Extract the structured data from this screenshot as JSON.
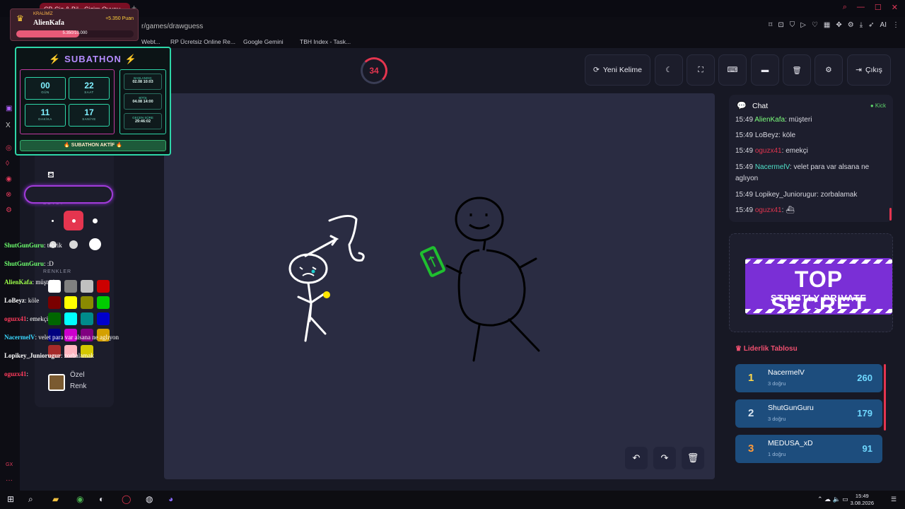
{
  "browser": {
    "tab_title": "ÇB Çiz & Bil - Çizim Oyunu",
    "url": "r/games/drawguess",
    "bookmarks": [
      "Webt...",
      "RP Ücretsiz Online Re...",
      "Google Gemini",
      "TBH Index - Task..."
    ],
    "ext_ai": "AI"
  },
  "crown": {
    "badge": "KRALİMİZ",
    "name": "AlienKafa",
    "points": "+5.350 Puan",
    "progress_text": "5.350/10.000",
    "progress_fraction": 0.535
  },
  "subathon": {
    "title": "⚡ SUBATHON ⚡",
    "days": "00",
    "days_lbl": "GÜN",
    "hours": "22",
    "hours_lbl": "SAAT",
    "minutes": "11",
    "minutes_lbl": "DAKİKA",
    "seconds": "17",
    "seconds_lbl": "SANİYE",
    "start_lbl": "BAŞLANGIÇ",
    "start": "02.08 10:03",
    "end_lbl": "BİTİŞ",
    "end": "04.08 14:00",
    "elapsed_lbl": "GEÇEN SÜRE",
    "elapsed": "29:46:02",
    "status": "🔥 SUBATHON AKTİF 🔥"
  },
  "game": {
    "timer": "34",
    "buttons": {
      "new_word": "Yeni Kelime",
      "exit": "Çıkış"
    }
  },
  "tools": {
    "size_label": "BOYUT",
    "colors_label": "RENKLER",
    "custom_color_line1": "Özel",
    "custom_color_line2": "Renk",
    "swatches": [
      "#ffffff",
      "#808080",
      "#c0c0c0",
      "#cc0000",
      "#7a0000",
      "#ffff00",
      "#8a8a00",
      "#00cc00",
      "#006600",
      "#00ffff",
      "#008b8b",
      "#0000cc",
      "#000080",
      "#cc00cc",
      "#800080",
      "#d4a000",
      "#a52a2a",
      "#ffb6c1",
      "#d4c800"
    ]
  },
  "overlay_chat": [
    {
      "user": "ShutGunGuru",
      "msg": "tebrik",
      "color": "#6dff6d"
    },
    {
      "user": "ShutGunGuru",
      "msg": ":D",
      "color": "#6dff6d"
    },
    {
      "user": "AlienKafa",
      "msg": "müşteri",
      "color": "#9dff4a"
    },
    {
      "user": "LoBeyz",
      "msg": "köle",
      "color": "#ffffff"
    },
    {
      "user": "oguzx41",
      "msg": "emekçi",
      "color": "#ff3b5c"
    },
    {
      "user": "NacermelV",
      "msg": "velet para var alsana ne aglıyon",
      "color": "#3ad8ff"
    },
    {
      "user": "Lopikey_Juniorugur",
      "msg": "zorbalamak",
      "color": "#ffffff"
    },
    {
      "user": "oguzx41",
      "msg": "",
      "color": "#ff3b5c"
    }
  ],
  "chat": {
    "title": "Chat",
    "platform": "Kick",
    "messages": [
      {
        "time": "15:49",
        "user": "AlienKafa",
        "msg": "müşteri",
        "color": "#7dff7d"
      },
      {
        "time": "15:49",
        "user": "LoBeyz",
        "msg": "köle",
        "color": "#d8d8e0"
      },
      {
        "time": "15:49",
        "user": "oguzx41",
        "msg": "emekçi",
        "color": "#e0354f"
      },
      {
        "time": "15:49",
        "user": "NacermelV",
        "msg": "velet para var alsana ne aglıyon",
        "color": "#4fe0c8"
      },
      {
        "time": "15:49",
        "user": "Lopikey_Juniorugur",
        "msg": "zorbalamak",
        "color": "#d8d8e0"
      },
      {
        "time": "15:49",
        "user": "oguzx41",
        "msg": "⛴",
        "color": "#e0354f"
      }
    ]
  },
  "ad": {
    "line1": "TOP SECRET",
    "line2": "STRICTLY PRIVATE"
  },
  "leaderboard": {
    "title": "Liderlik Tablosu",
    "rows": [
      {
        "rank": "1",
        "name": "NacermelV",
        "sub": "3 doğru",
        "score": "260",
        "rank_color": "#ffd84a"
      },
      {
        "rank": "2",
        "name": "ShutGunGuru",
        "sub": "3 doğru",
        "score": "179",
        "rank_color": "#d8e4f0"
      },
      {
        "rank": "3",
        "name": "MEDUSA_xD",
        "sub": "1 doğru",
        "score": "91",
        "rank_color": "#ff9a3a"
      }
    ]
  },
  "taskbar": {
    "time": "15:49",
    "date": "3.08.2026"
  }
}
